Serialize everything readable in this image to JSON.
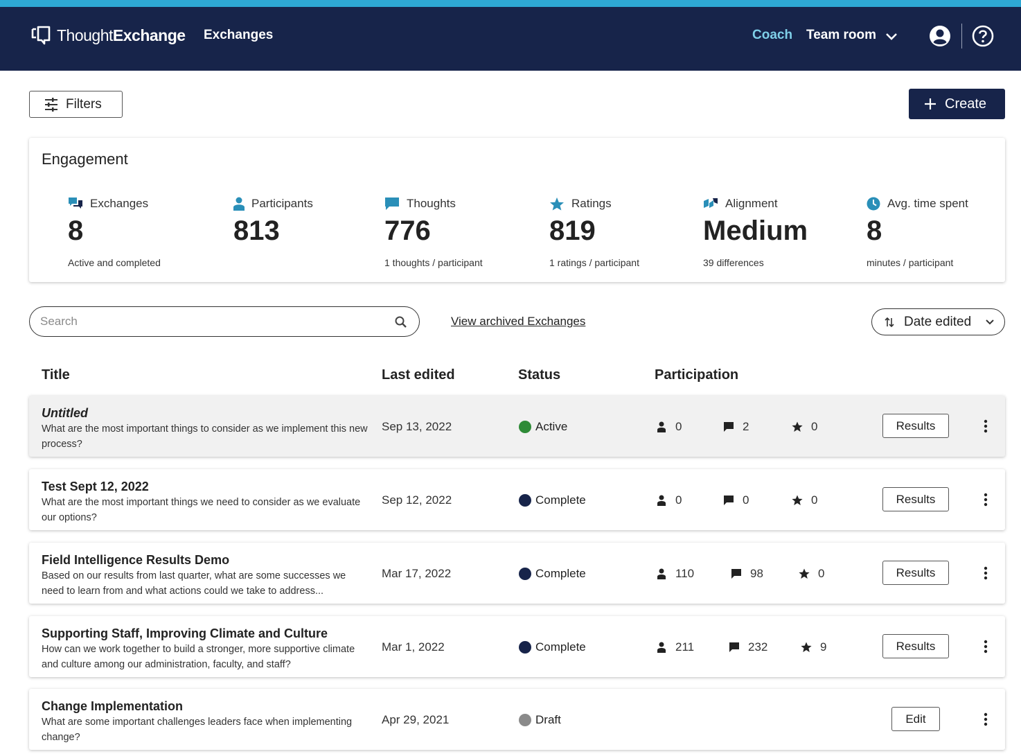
{
  "colors": {
    "navy": "#17244a",
    "accent": "#2ea8d4",
    "coach": "#7fcfe8",
    "active": "#2e8b37",
    "complete": "#17244a",
    "draft": "#8a8a8a"
  },
  "nav": {
    "logo_light": "Thought",
    "logo_bold": "Exchange",
    "exchanges": "Exchanges",
    "coach": "Coach",
    "team_room": "Team room",
    "icons": [
      "chevron-down-icon",
      "user-icon",
      "help-icon"
    ]
  },
  "toolbar": {
    "filters_label": "Filters",
    "create_label": "Create"
  },
  "engagement": {
    "title": "Engagement",
    "stats": [
      {
        "label": "Exchanges",
        "value": "8",
        "sub": "Active and completed",
        "icon": "exchanges-icon"
      },
      {
        "label": "Participants",
        "value": "813",
        "sub": "",
        "icon": "person-icon"
      },
      {
        "label": "Thoughts",
        "value": "776",
        "sub": "1 thoughts / participant",
        "icon": "chat-icon"
      },
      {
        "label": "Ratings",
        "value": "819",
        "sub": "1 ratings / participant",
        "icon": "star-icon"
      },
      {
        "label": "Alignment",
        "value": "Medium",
        "sub": "39 differences",
        "icon": "alignment-icon"
      },
      {
        "label": "Avg. time spent",
        "value": "8",
        "sub": "minutes / participant",
        "icon": "clock-icon"
      }
    ]
  },
  "search": {
    "placeholder": "Search"
  },
  "archived_link": "View archived Exchanges",
  "sort": {
    "label": "Date edited"
  },
  "table": {
    "headers": {
      "title": "Title",
      "last_edited": "Last edited",
      "status": "Status",
      "participation": "Participation"
    },
    "rows": [
      {
        "title": "Untitled",
        "desc": "What are the most important things to consider as we implement this new process?",
        "date": "Sep 13, 2022",
        "status": "Active",
        "participants": "0",
        "thoughts": "2",
        "ratings": "0",
        "action": "Results"
      },
      {
        "title": "Test Sept 12, 2022",
        "desc": "What are the most important things we need to consider as we evaluate our options?",
        "date": "Sep 12, 2022",
        "status": "Complete",
        "participants": "0",
        "thoughts": "0",
        "ratings": "0",
        "action": "Results"
      },
      {
        "title": "Field Intelligence Results Demo",
        "desc": "Based on our results from last quarter, what are some successes we need to learn from and what actions could we take to address...",
        "date": "Mar 17, 2022",
        "status": "Complete",
        "participants": "110",
        "thoughts": "98",
        "ratings": "0",
        "action": "Results"
      },
      {
        "title": "Supporting Staff, Improving Climate and Culture",
        "desc": "How can we work together to build a stronger, more supportive climate and culture among our administration, faculty, and staff?",
        "date": "Mar 1, 2022",
        "status": "Complete",
        "participants": "211",
        "thoughts": "232",
        "ratings": "9",
        "action": "Results"
      },
      {
        "title": "Change Implementation",
        "desc": "What are some important challenges leaders face when implementing change?",
        "date": "Apr 29, 2021",
        "status": "Draft",
        "participants": "",
        "thoughts": "",
        "ratings": "",
        "action": "Edit"
      }
    ]
  }
}
